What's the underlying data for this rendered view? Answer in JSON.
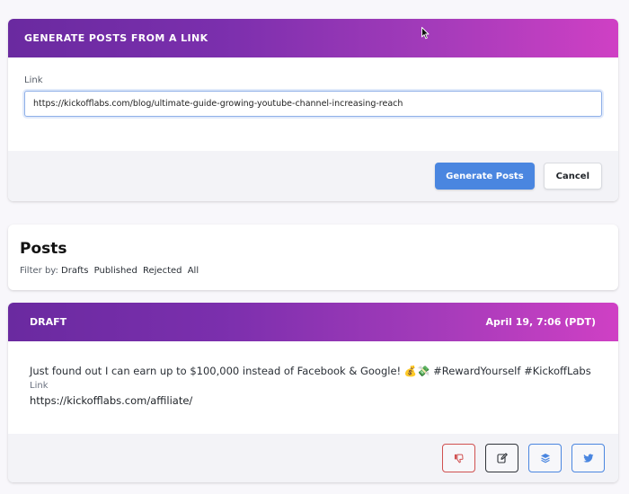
{
  "generate": {
    "header": "GENERATE POSTS FROM A LINK",
    "link_label": "Link",
    "link_value": "https://kickofflabs.com/blog/ultimate-guide-growing-youtube-channel-increasing-reach",
    "generate_button": "Generate Posts",
    "cancel_button": "Cancel"
  },
  "posts": {
    "title": "Posts",
    "filter_label": "Filter by:",
    "filters": [
      "Drafts",
      "Published",
      "Rejected",
      "All"
    ]
  },
  "draft": {
    "status": "DRAFT",
    "timestamp": "April 19, 7:06 (PDT)",
    "text": "Just found out I can earn up to $100,000 instead of Facebook & Google! 💰💸 #RewardYourself #KickoffLabs",
    "link_label": "Link",
    "link": "https://kickofflabs.com/affiliate/",
    "actions": {
      "reject_icon": "thumbs-down-icon",
      "edit_icon": "edit-icon",
      "layers_icon": "layers-icon",
      "twitter_icon": "twitter-icon"
    }
  },
  "colors": {
    "gradient_start": "#6a2aa0",
    "gradient_end": "#cf40c4",
    "primary": "#4a86e0",
    "reject": "#d05050"
  }
}
